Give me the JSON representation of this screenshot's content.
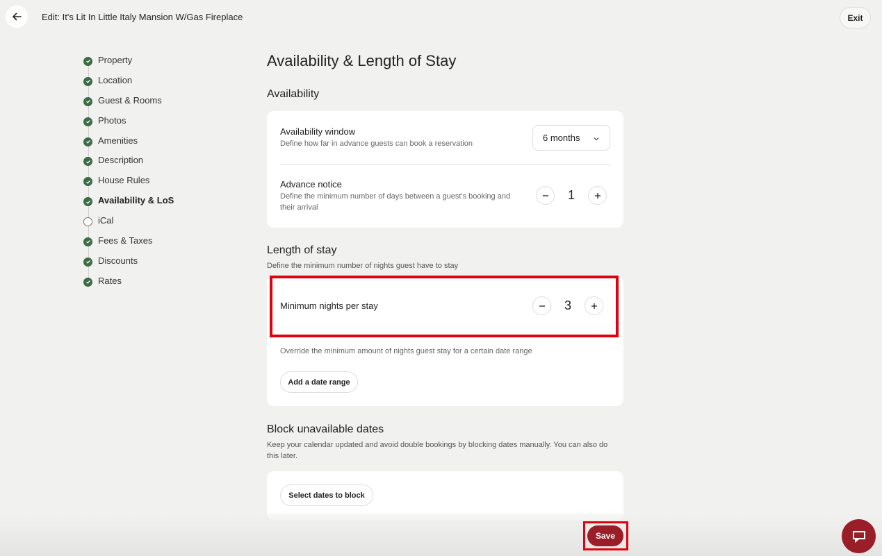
{
  "header": {
    "title": "Edit: It's Lit In Little Italy Mansion W/Gas Fireplace",
    "exit_label": "Exit"
  },
  "sidebar": {
    "items": [
      {
        "label": "Property",
        "status": "complete"
      },
      {
        "label": "Location",
        "status": "complete"
      },
      {
        "label": "Guest & Rooms",
        "status": "complete"
      },
      {
        "label": "Photos",
        "status": "complete"
      },
      {
        "label": "Amenities",
        "status": "complete"
      },
      {
        "label": "Description",
        "status": "complete"
      },
      {
        "label": "House Rules",
        "status": "complete"
      },
      {
        "label": "Availability & LoS",
        "status": "complete",
        "active": true
      },
      {
        "label": "iCal",
        "status": "incomplete"
      },
      {
        "label": "Fees & Taxes",
        "status": "complete"
      },
      {
        "label": "Discounts",
        "status": "complete"
      },
      {
        "label": "Rates",
        "status": "complete"
      }
    ]
  },
  "main": {
    "title": "Availability & Length of Stay",
    "availability": {
      "heading": "Availability",
      "window": {
        "title": "Availability window",
        "subtitle": "Define how far in advance guests can book a reservation",
        "selected": "6 months"
      },
      "notice": {
        "title": "Advance notice",
        "subtitle": "Define the minimum number of days between a guest's booking and their arrival",
        "value": "1"
      }
    },
    "length_of_stay": {
      "heading": "Length of stay",
      "subtitle": "Define the minimum number of nights guest have to stay",
      "min_nights": {
        "title": "Minimum nights per stay",
        "value": "3"
      },
      "override_text": "Override the minimum amount of nights guest stay for a certain date range",
      "add_range_label": "Add a date range"
    },
    "block_dates": {
      "heading": "Block unavailable dates",
      "subtitle": "Keep your calendar updated and avoid double bookings by blocking dates manually. You can also do this later.",
      "select_label": "Select dates to block"
    }
  },
  "footer": {
    "save_label": "Save"
  },
  "colors": {
    "accent": "#9a1e28",
    "complete_step": "#3d6b45",
    "highlight": "#e0000e"
  }
}
